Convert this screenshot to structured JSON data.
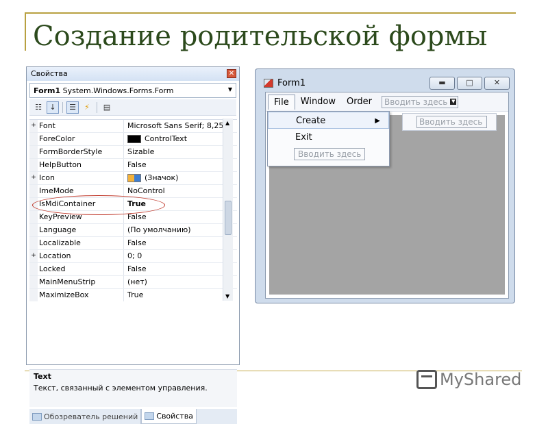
{
  "slide": {
    "title": "Создание родительской формы",
    "logo": "MyShared"
  },
  "properties_panel": {
    "title": "Свойства",
    "close_glyph": "✕",
    "object_name": "Form1",
    "object_type": "System.Windows.Forms.Form",
    "toolbar": [
      "categorized-icon",
      "alphabetical-icon",
      "properties-icon",
      "events-icon",
      "property-pages-icon"
    ],
    "rows": [
      {
        "expand": "+",
        "name": "Font",
        "value": "Microsoft Sans Serif; 8,25pt"
      },
      {
        "expand": "",
        "name": "ForeColor",
        "value": "ControlText",
        "swatch": "black"
      },
      {
        "expand": "",
        "name": "FormBorderStyle",
        "value": "Sizable"
      },
      {
        "expand": "",
        "name": "HelpButton",
        "value": "False"
      },
      {
        "expand": "+",
        "name": "Icon",
        "value": "(Значок)",
        "swatch": "icon"
      },
      {
        "expand": "",
        "name": "ImeMode",
        "value": "NoControl"
      },
      {
        "expand": "",
        "name": "IsMdiContainer",
        "value": "True",
        "bold": true
      },
      {
        "expand": "",
        "name": "KeyPreview",
        "value": "False"
      },
      {
        "expand": "",
        "name": "Language",
        "value": "(По умолчанию)"
      },
      {
        "expand": "",
        "name": "Localizable",
        "value": "False"
      },
      {
        "expand": "+",
        "name": "Location",
        "value": "0; 0"
      },
      {
        "expand": "",
        "name": "Locked",
        "value": "False"
      },
      {
        "expand": "",
        "name": "MainMenuStrip",
        "value": "(нет)"
      },
      {
        "expand": "",
        "name": "MaximizeBox",
        "value": "True"
      }
    ],
    "description_title": "Text",
    "description_text": "Текст, связанный с элементом управления.",
    "tabs": [
      {
        "label": "Обозреватель решений"
      },
      {
        "label": "Свойства"
      }
    ]
  },
  "form_window": {
    "title": "Form1",
    "menu": [
      "File",
      "Window",
      "Order"
    ],
    "type_here": "Вводить здесь",
    "dropdown_items": [
      "Create",
      "Exit"
    ],
    "submenu_arrow": "▶"
  }
}
